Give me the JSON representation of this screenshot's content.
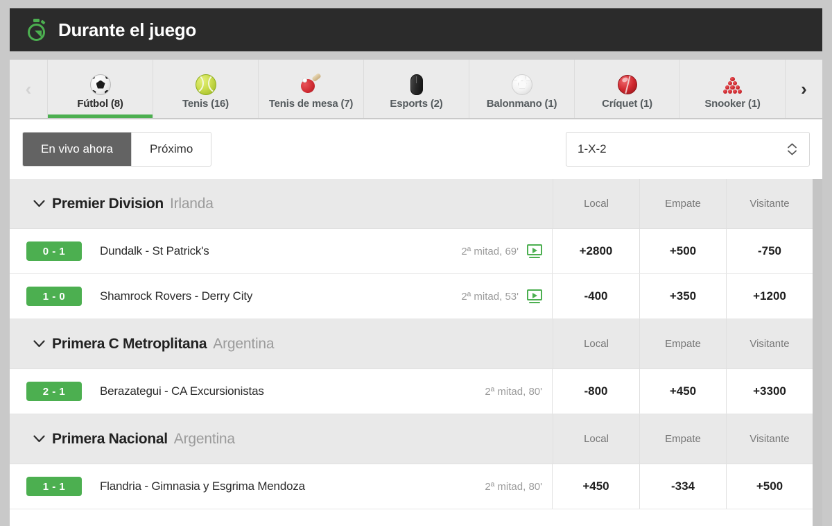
{
  "header": {
    "title": "Durante el juego",
    "icon": "stopwatch-icon"
  },
  "tabs_nav": {
    "prev_label": "‹",
    "next_label": "›"
  },
  "sport_tabs": [
    {
      "label": "Fútbol (8)",
      "icon": "soccer-ball-icon",
      "active": true
    },
    {
      "label": "Tenis (16)",
      "icon": "tennis-ball-icon",
      "active": false
    },
    {
      "label": "Tenis de mesa (7)",
      "icon": "table-tennis-paddle-icon",
      "active": false
    },
    {
      "label": "Esports (2)",
      "icon": "computer-mouse-icon",
      "active": false
    },
    {
      "label": "Balonmano (1)",
      "icon": "handball-icon",
      "active": false
    },
    {
      "label": "Críquet (1)",
      "icon": "cricket-ball-icon",
      "active": false
    },
    {
      "label": "Snooker (1)",
      "icon": "snooker-balls-icon",
      "active": false
    }
  ],
  "filters": {
    "segments": [
      {
        "label": "En vivo ahora",
        "active": true
      },
      {
        "label": "Próximo",
        "active": false
      }
    ],
    "market_select": {
      "value": "1-X-2",
      "options": [
        "1-X-2"
      ]
    }
  },
  "column_headers": [
    "Local",
    "Empate",
    "Visitante"
  ],
  "leagues": [
    {
      "name": "Premier Division",
      "country": "Irlanda",
      "matches": [
        {
          "score": "0 - 1",
          "teams": "Dundalk  - St Patrick's",
          "time": "2ª mitad, 69'",
          "has_stream": true,
          "odds": [
            "+2800",
            "+500",
            "-750"
          ]
        },
        {
          "score": "1 - 0",
          "teams": "Shamrock Rovers  - Derry City",
          "time": "2ª mitad, 53'",
          "has_stream": true,
          "odds": [
            "-400",
            "+350",
            "+1200"
          ]
        }
      ]
    },
    {
      "name": "Primera C Metroplitana",
      "country": "Argentina",
      "matches": [
        {
          "score": "2 - 1",
          "teams": "Berazategui  - CA Excursionistas",
          "time": "2ª mitad, 80'",
          "has_stream": false,
          "odds": [
            "-800",
            "+450",
            "+3300"
          ]
        }
      ]
    },
    {
      "name": "Primera Nacional",
      "country": "Argentina",
      "matches": [
        {
          "score": "1 - 1",
          "teams": "Flandria  - Gimnasia y Esgrima Mendoza",
          "time": "2ª mitad, 80'",
          "has_stream": false,
          "odds": [
            "+450",
            "-334",
            "+500"
          ]
        }
      ]
    }
  ],
  "colors": {
    "header_bg": "#2b2b2b",
    "accent_green": "#4caf50",
    "active_segment": "#636363",
    "league_bg": "#e9e9e9",
    "page_bg": "#c9c9c9"
  }
}
